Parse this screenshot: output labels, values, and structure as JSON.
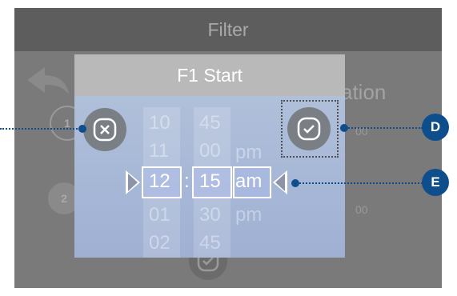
{
  "screen": {
    "title": "Filter",
    "bg_circle_1": "1",
    "bg_circle_2": "2",
    "bg_label": "ation",
    "bg_time_1": "00",
    "bg_time_2": "00"
  },
  "dialog": {
    "title": "F1 Start",
    "hours": [
      "10",
      "11",
      "12",
      "01",
      "02"
    ],
    "minutes": [
      "45",
      "00",
      "15",
      "30",
      "45"
    ],
    "ampm": [
      "pm",
      "am",
      "pm"
    ],
    "separator": ":",
    "selected": {
      "hour": "12",
      "minute": "15",
      "ampm": "am"
    }
  },
  "callouts": {
    "d": "D",
    "e": "E"
  },
  "colors": {
    "dialog_bg": "#a9b9d8",
    "title_bar": "#b9b9b9",
    "button_gray": "#7a7f86",
    "callout_blue": "#0e4e8c"
  },
  "icons": [
    "back-arrow-icon",
    "cancel-x-icon",
    "confirm-check-icon"
  ]
}
